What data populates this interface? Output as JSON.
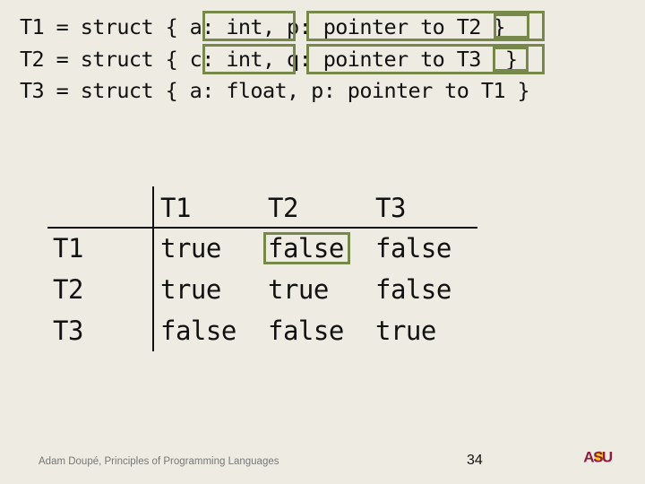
{
  "code": {
    "lines": [
      "T1 = struct { a: int, p: pointer to T2 }",
      "T2 = struct { c: int, q: pointer to T3  }",
      "T3 = struct { a: float, p: pointer to T1 }"
    ]
  },
  "table": {
    "col_headers": [
      "T1",
      "T2",
      "T3"
    ],
    "row_headers": [
      "T1",
      "T2",
      "T3"
    ],
    "rows": [
      [
        "true",
        "false",
        "false"
      ],
      [
        "true",
        "true",
        "false"
      ],
      [
        "false",
        "false",
        "true"
      ]
    ]
  },
  "footer": {
    "text": "Adam Doupé, Principles of Programming Languages",
    "page_number": "34",
    "logo": "ASU"
  },
  "colors": {
    "background": "#eeebe2",
    "highlight": "#76894a",
    "logo_maroon": "#8c1d40",
    "logo_gold": "#ffc627"
  }
}
